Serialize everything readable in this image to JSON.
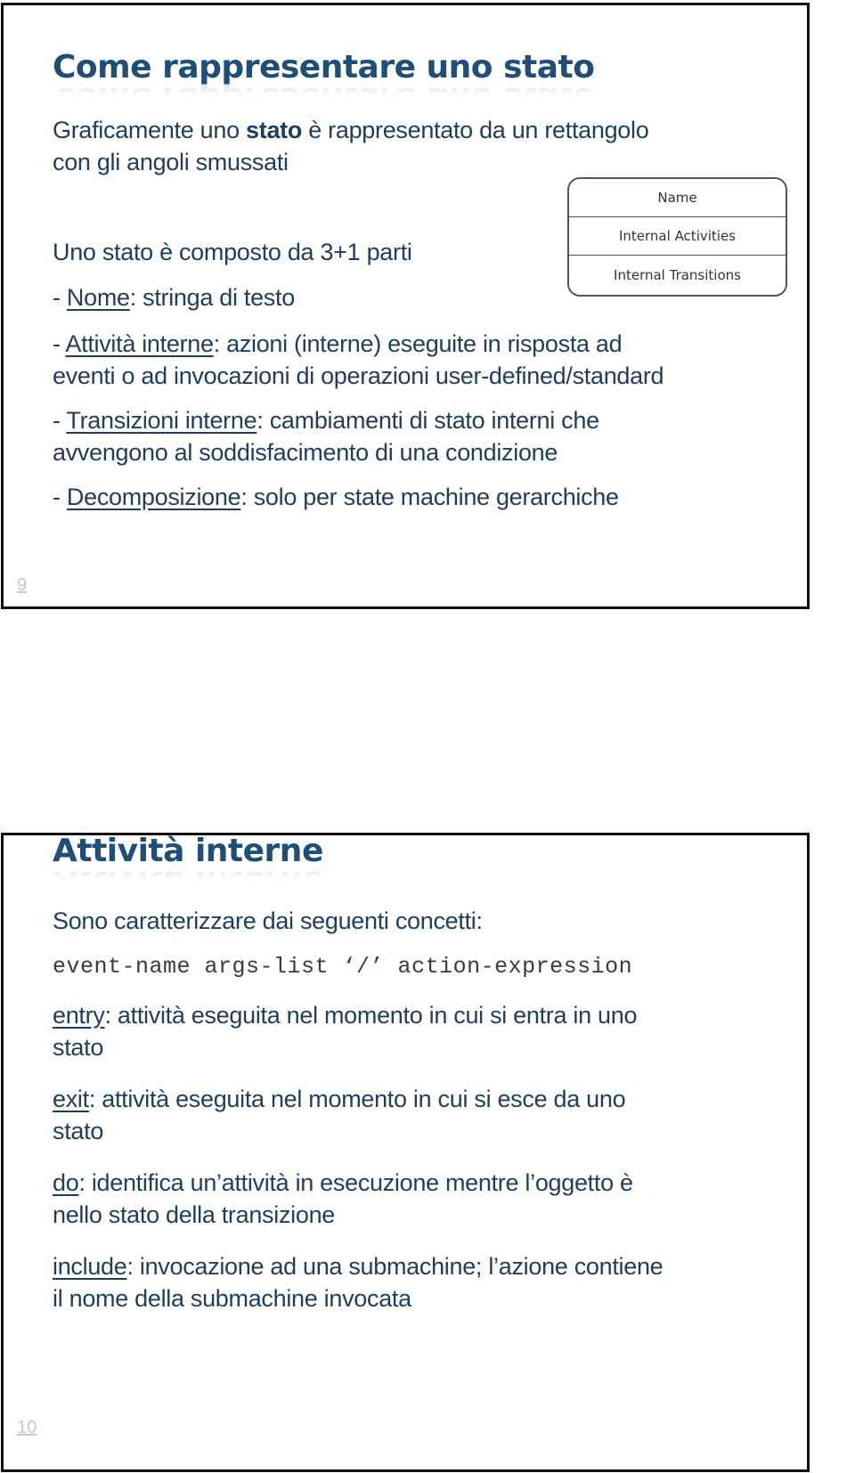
{
  "slides": [
    {
      "page_number": "9",
      "title": "Come rappresentare uno stato",
      "intro": {
        "before": "Graficamente uno ",
        "bold": "stato",
        "after_line1": " è rappresentato da un rettangolo",
        "line2": "con gli angoli smussati"
      },
      "composition_line": "Uno stato è composto da 3+1 parti",
      "parts": [
        {
          "term": "Nome",
          "text_line1": ": stringa di testo",
          "text_line2": ""
        },
        {
          "term": "Attività interne",
          "text_line1": ": azioni (interne) eseguite in risposta ad",
          "text_line2": "eventi o ad invocazioni di operazioni user-defined/standard"
        },
        {
          "term": "Transizioni interne",
          "text_line1": ": cambiamenti di stato interni che",
          "text_line2": "avvengono al soddisfacimento di una condizione"
        },
        {
          "term": "Decomposizione",
          "text_line1": ": solo per state machine gerarchiche",
          "text_line2": ""
        }
      ],
      "diagram": {
        "compartments": [
          "Name",
          "Internal Activities",
          "Internal Transitions"
        ]
      }
    },
    {
      "page_number": "10",
      "title": "Attività interne",
      "intro": "Sono caratterizzare dai seguenti concetti:",
      "syntax": "event-name args-list ‘/’ action-expression",
      "concepts": [
        {
          "term": "entry",
          "text_line1": ": attività eseguita nel momento in cui si entra in uno",
          "text_line2": "stato"
        },
        {
          "term": "exit",
          "text_line1": ": attività eseguita nel momento in cui si esce da uno",
          "text_line2": "stato"
        },
        {
          "term": "do",
          "text_line1": ": identifica un’attività in esecuzione mentre l’oggetto è",
          "text_line2": "nello stato della transizione"
        },
        {
          "term": "include",
          "text_line1": ": invocazione ad una submachine; l’azione contiene",
          "text_line2": "il nome della submachine invocata"
        }
      ]
    }
  ]
}
